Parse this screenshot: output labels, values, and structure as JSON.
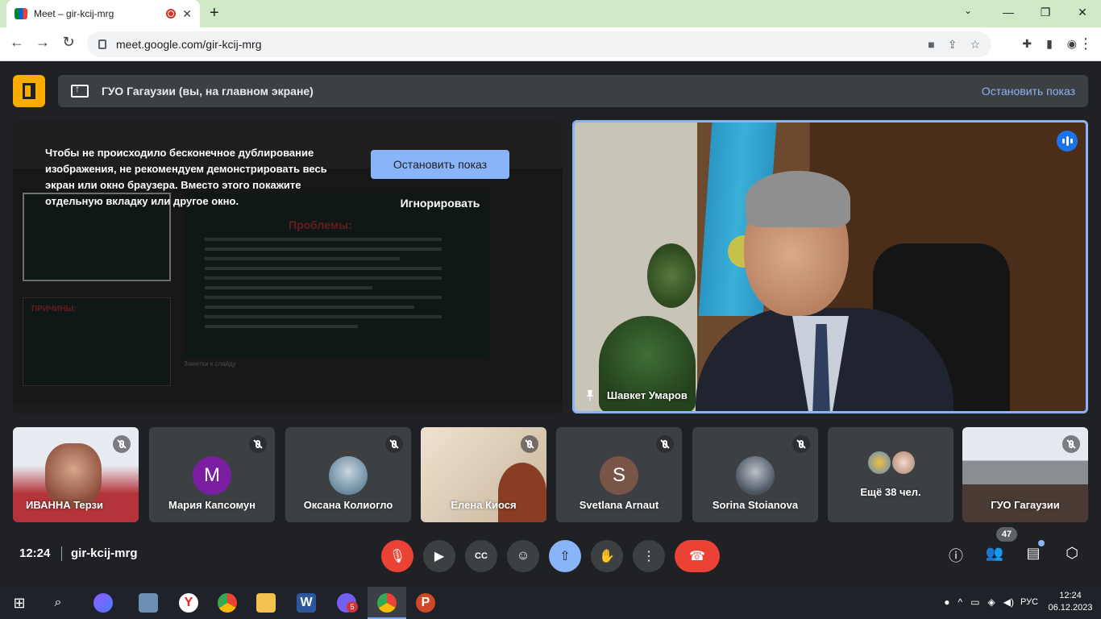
{
  "browser": {
    "tab_title": "Meet – gir-kcij-mrg",
    "url": "meet.google.com/gir-kcij-mrg",
    "window_buttons": [
      "—",
      "❐",
      "✕"
    ]
  },
  "presenting": {
    "banner_title": "ГУО Гагаузии (вы, на главном экране)",
    "stop_label": "Остановить показ"
  },
  "share_overlay": {
    "message": "Чтобы не происходило бесконечное дублирование изображения, не рекомендуем демонстрировать весь экран или окно браузера. Вместо этого покажите отдельную вкладку или другое окно.",
    "stop_button": "Остановить показ",
    "ignore_button": "Игнорировать",
    "slide_heading": "Проблемы:",
    "slide_heading2": "ПРИЧИНЫ:",
    "notes_placeholder": "Заметки к слайду"
  },
  "main_speaker": {
    "name": "Шавкет Умаров"
  },
  "participants": [
    {
      "name": "ИВАННА Терзи",
      "type": "video"
    },
    {
      "name": "Мария Капсомун",
      "type": "letter",
      "letter": "M",
      "color": "#7b1fa2"
    },
    {
      "name": "Оксана Колиогло",
      "type": "photo"
    },
    {
      "name": "Елена Киося",
      "type": "video"
    },
    {
      "name": "Svetlana Arnaut",
      "type": "letter",
      "letter": "S",
      "color": "#795548"
    },
    {
      "name": "Sorina Stoianova",
      "type": "photo"
    },
    {
      "name": "Ещё 38 чел.",
      "type": "more"
    },
    {
      "name": "ГУО Гагаузии",
      "type": "video"
    }
  ],
  "bottom": {
    "time": "12:24",
    "meeting_code": "gir-kcij-mrg",
    "people_count": "47"
  },
  "taskbar": {
    "time": "12:24",
    "date": "06.12.2023",
    "language": "РУС",
    "viber_badge": "5"
  },
  "colors": {
    "accent": "#8ab4f8",
    "danger": "#ea4335",
    "present_icon": "#f9ab00",
    "surface": "#3c4043",
    "background": "#202124"
  }
}
